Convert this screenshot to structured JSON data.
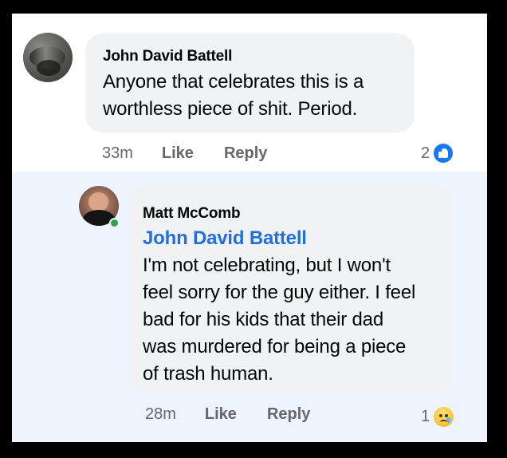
{
  "comments": [
    {
      "author": "John David Battell",
      "text_lines": [
        "Anyone that celebrates this is a",
        "worthless piece of shit. Period."
      ],
      "time": "33m",
      "like_label": "Like",
      "reply_label": "Reply",
      "reaction_count": "2",
      "reaction_icon": "like-icon"
    },
    {
      "author": "Matt McComb",
      "mention": "John David Battell",
      "text_lines": [
        "I'm not celebrating, but I won't",
        "feel sorry for the guy either. I feel",
        "bad for his kids that their dad",
        "was murdered for being a piece",
        "of trash human."
      ],
      "time": "28m",
      "like_label": "Like",
      "reply_label": "Reply",
      "reaction_count": "1",
      "reaction_icon": "sad-icon"
    }
  ],
  "colors": {
    "outer_border": "#000000",
    "page_background": "#ffffff",
    "reply_thread_background": "#eef4fd",
    "comment_bubble": "#f0f2f5",
    "mention_blue": "#216fdb",
    "meta_gray": "#65676b",
    "like_blue": "#1877f2",
    "online_green": "#31a24c"
  }
}
